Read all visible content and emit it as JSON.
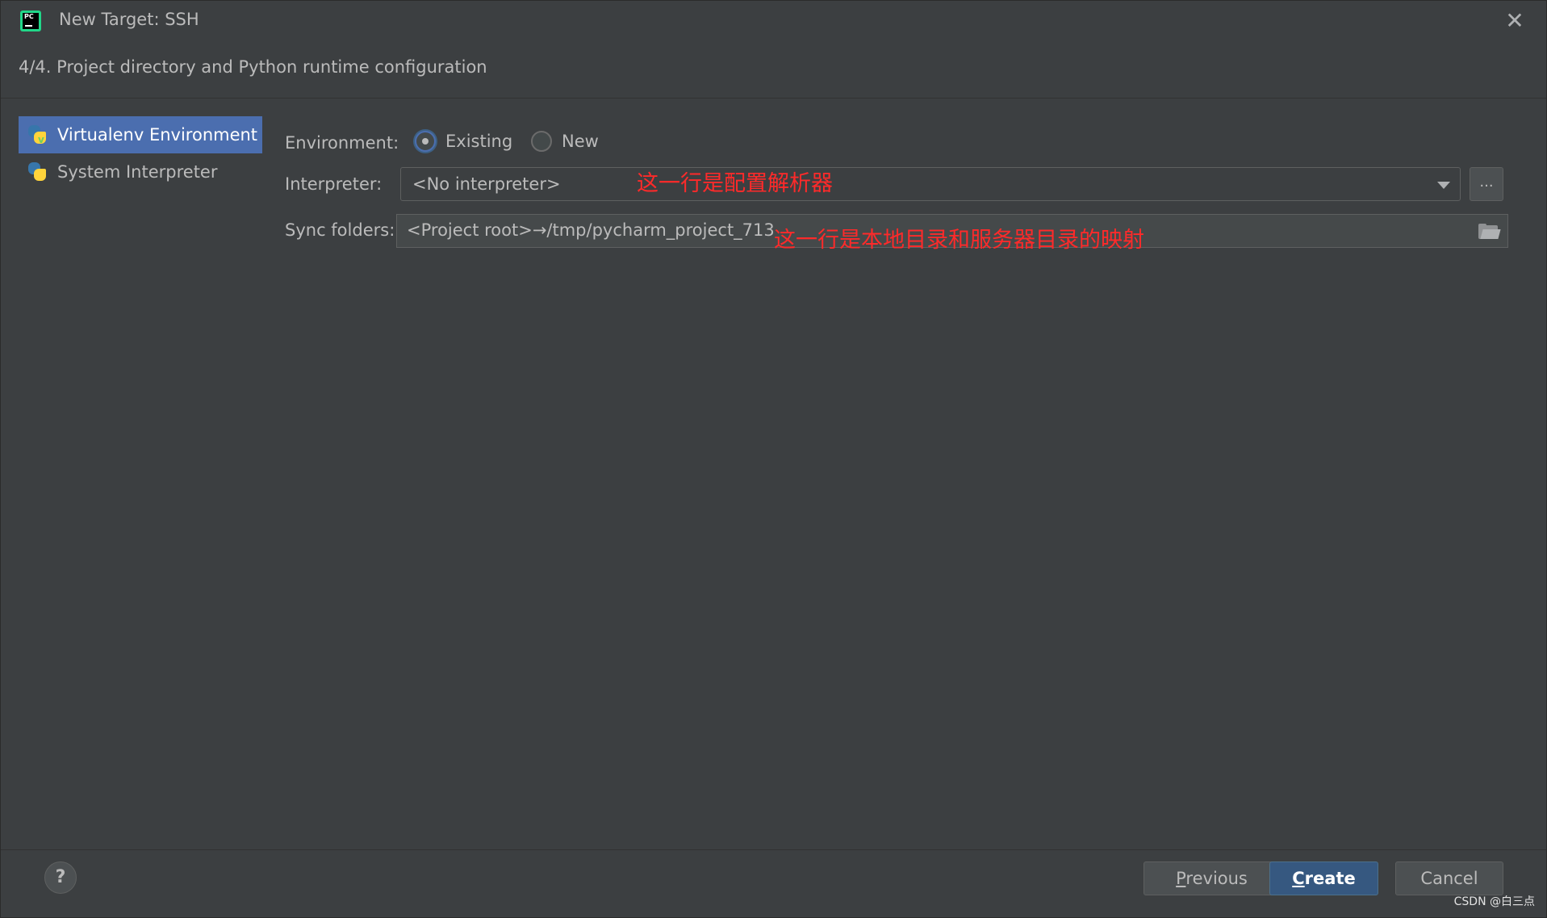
{
  "window": {
    "title": "New Target: SSH",
    "close_icon": "close-icon",
    "app_icon_text": "PC"
  },
  "step": {
    "title": "4/4. Project directory and Python runtime configuration"
  },
  "sidebar": {
    "items": [
      {
        "label": "Virtualenv Environment",
        "selected": true,
        "icon": "python-virtualenv-icon"
      },
      {
        "label": "System Interpreter",
        "selected": false,
        "icon": "python-icon"
      }
    ]
  },
  "form": {
    "environment_label": "Environment:",
    "environment_options": [
      {
        "label": "Existing",
        "checked": true
      },
      {
        "label": "New",
        "checked": false
      }
    ],
    "interpreter_label": "Interpreter:",
    "interpreter_value": "<No interpreter>",
    "browse_label": "...",
    "sync_label": "Sync folders:",
    "sync_value": "<Project root>→/tmp/pycharm_project_713"
  },
  "annotations": {
    "interpreter_note": "这一行是配置解析器",
    "sync_note": "这一行是本地目录和服务器目录的映射"
  },
  "footer": {
    "help_label": "?",
    "previous": {
      "mnemonic": "P",
      "rest": "revious"
    },
    "create": {
      "mnemonic": "C",
      "rest": "reate"
    },
    "cancel_label": "Cancel"
  },
  "watermark": "CSDN @白三点",
  "colors": {
    "background": "#3c3f41",
    "selection": "#4b6eaf",
    "primary_button": "#365880",
    "annotation": "#ff2a2a"
  }
}
